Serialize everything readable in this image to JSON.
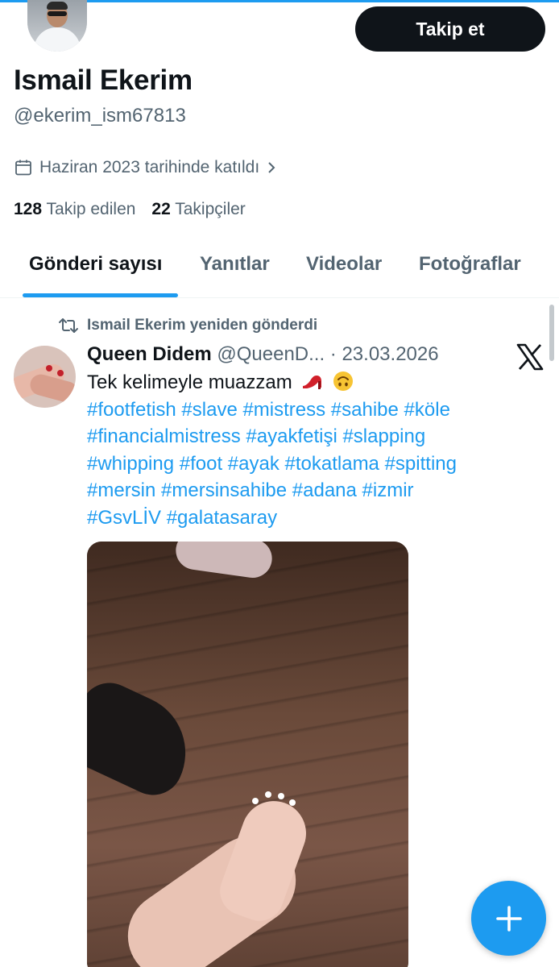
{
  "profile": {
    "display_name": "Ismail Ekerim",
    "handle": "@ekerim_ism67813",
    "joined": "Haziran 2023 tarihinde katıldı",
    "following_count": "128",
    "following_label": "Takip edilen",
    "followers_count": "22",
    "followers_label": "Takipçiler",
    "follow_button": "Takip et"
  },
  "tabs": [
    {
      "label": "Gönderi sayısı",
      "active": true
    },
    {
      "label": "Yanıtlar",
      "active": false
    },
    {
      "label": "Videolar",
      "active": false
    },
    {
      "label": "Fotoğraflar",
      "active": false
    }
  ],
  "tweet": {
    "retweet_label": "Ismail Ekerim yeniden gönderdi",
    "author": "Queen Didem",
    "meta": "@QueenD... · 23.03.2026",
    "text": "Tek kelimeyle muazzam",
    "hashtag_lines": [
      "#footfetish #slave #mistress #sahibe #köle",
      "#financialmistress #ayakfetişi #slapping",
      "#whipping #foot #ayak #tokatlama #spitting",
      "#mersin #mersinsahibe #adana #izmir",
      "#GsvLİV #galatasaray"
    ]
  },
  "colors": {
    "accent": "#1d9bf0",
    "text": "#0f1419",
    "secondary": "#536471",
    "button_dark": "#0f1419"
  },
  "icons": [
    "calendar-icon",
    "chevron-right-icon",
    "retweet-icon",
    "x-logo-icon",
    "plus-icon"
  ]
}
